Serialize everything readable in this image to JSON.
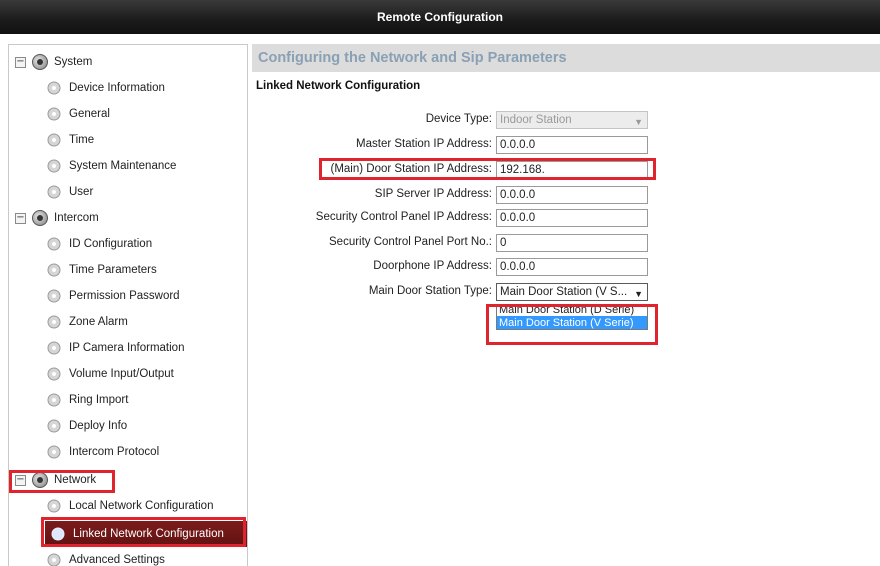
{
  "window": {
    "title": "Remote Configuration"
  },
  "sidebar": {
    "groups": [
      {
        "label": "System",
        "toggle": "−",
        "items": [
          "Device Information",
          "General",
          "Time",
          "System Maintenance",
          "User"
        ]
      },
      {
        "label": "Intercom",
        "toggle": "−",
        "items": [
          "ID Configuration",
          "Time Parameters",
          "Permission Password",
          "Zone Alarm",
          "IP Camera Information",
          "Volume Input/Output",
          "Ring Import",
          "Deploy Info",
          "Intercom Protocol"
        ]
      },
      {
        "label": "Network",
        "toggle": "−",
        "items": [
          "Local Network Configuration",
          "Linked Network Configuration",
          "Advanced Settings"
        ]
      }
    ],
    "selected_item": "Linked Network Configuration"
  },
  "main": {
    "header": "Configuring the Network and Sip Parameters",
    "section_title": "Linked Network Configuration",
    "fields": {
      "device_type": {
        "label": "Device Type:",
        "value": "Indoor Station"
      },
      "master_station_ip": {
        "label": "Master Station IP Address:",
        "value": "0.0.0.0"
      },
      "main_door_station_ip": {
        "label": "(Main) Door Station IP Address:",
        "value": "192.168."
      },
      "sip_server_ip": {
        "label": "SIP Server IP Address:",
        "value": "0.0.0.0"
      },
      "security_panel_ip": {
        "label": "Security Control Panel IP Address:",
        "value": "0.0.0.0"
      },
      "security_panel_port": {
        "label": "Security Control Panel Port No.:",
        "value": "0"
      },
      "doorphone_ip": {
        "label": "Doorphone IP Address:",
        "value": "0.0.0.0"
      },
      "main_door_station_type": {
        "label": "Main Door Station Type:",
        "value": "Main Door Station (V S..."
      }
    },
    "dropdown_options": [
      "Main Door Station (D Serie)",
      "Main Door Station (V Serie)"
    ]
  },
  "colors": {
    "selected_bg": "#6e1616",
    "annotation": "#e0242e",
    "highlight": "#3399ff"
  },
  "icons": {
    "group": "settings-globe-icon",
    "item": "gear-icon",
    "toggle": "collapse-icon",
    "dropdown": "chevron-down-icon"
  }
}
